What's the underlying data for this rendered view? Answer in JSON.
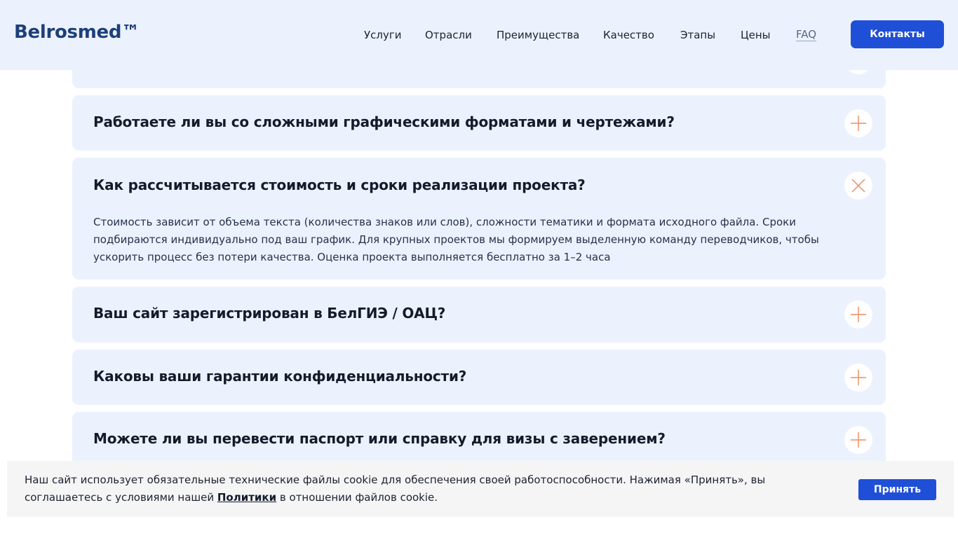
{
  "header": {
    "logo": "Belrosmed™",
    "nav": [
      {
        "label": "Услуги"
      },
      {
        "label": "Отрасли"
      },
      {
        "label": "Преимущества"
      },
      {
        "label": "Качество"
      },
      {
        "label": "Этапы"
      },
      {
        "label": "Цены"
      },
      {
        "label": "FAQ",
        "active": true
      }
    ],
    "contact_button": "Контакты"
  },
  "faq": [
    {
      "question": "",
      "state": "collapsed",
      "icon": "plus-icon"
    },
    {
      "question": "Работаете ли вы со сложными графическими форматами и чертежами?",
      "state": "collapsed",
      "icon": "plus-icon"
    },
    {
      "question": "Как рассчитывается стоимость и сроки реализации проекта?",
      "state": "expanded",
      "icon": "close-icon",
      "answer": "Стоимость зависит от объема текста (количества знаков или слов), сложности тематики и формата исходного файла. Сроки подбираются индивидуально под ваш график. Для крупных проектов мы формируем выделенную команду переводчиков, чтобы ускорить процесс без потери качества. Оценка проекта выполняется бесплатно за 1–2 часа"
    },
    {
      "question": "Ваш сайт зарегистрирован в БелГИЭ / ОАЦ?",
      "state": "collapsed",
      "icon": "plus-icon"
    },
    {
      "question": "Каковы ваши гарантии конфиденциальности?",
      "state": "collapsed",
      "icon": "plus-icon"
    },
    {
      "question": "Можете ли вы перевести паспорт или справку для визы с заверением?",
      "state": "collapsed",
      "icon": "plus-icon"
    }
  ],
  "cookie": {
    "text_before": "Наш сайт использует обязательные технические файлы cookie для обеспечения своей работоспособности. Нажимая «Принять», вы соглашаетесь с условиями нашей ",
    "link": "Политики",
    "text_after": " в отношении файлов cookie.",
    "accept_button": "Принять"
  },
  "colors": {
    "accent": "#1f4fd6",
    "icon": "#f08a5d",
    "panel": "#ecf2fd",
    "logo": "#1e3f7a"
  }
}
